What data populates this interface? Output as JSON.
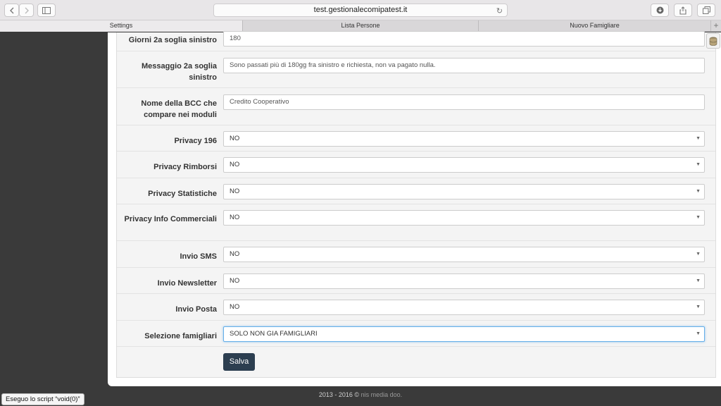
{
  "browser": {
    "url": "test.gestionalecomipatest.it",
    "tabs": [
      "Settings",
      "Lista Persone",
      "Nuovo Famigliare"
    ],
    "new_tab_glyph": "+"
  },
  "form": {
    "rows": [
      {
        "label": "Giorni 2a soglia sinistro",
        "value": "180",
        "type": "text"
      },
      {
        "label": "Messaggio 2a soglia sinistro",
        "value": "Sono passati più di 180gg fra sinistro e richiesta, non va pagato nulla.",
        "type": "text"
      },
      {
        "label": "Nome della BCC che compare nei moduli",
        "value": "Credito Cooperativo",
        "type": "text"
      },
      {
        "label": "Privacy 196",
        "value": "NO",
        "type": "select"
      },
      {
        "label": "Privacy Rimborsi",
        "value": "NO",
        "type": "select"
      },
      {
        "label": "Privacy Statistiche",
        "value": "NO",
        "type": "select"
      },
      {
        "label": "Privacy Info Commerciali",
        "value": "NO",
        "type": "select"
      },
      {
        "label": "Invio SMS",
        "value": "NO",
        "type": "select"
      },
      {
        "label": "Invio Newsletter",
        "value": "NO",
        "type": "select"
      },
      {
        "label": "Invio Posta",
        "value": "NO",
        "type": "select"
      },
      {
        "label": "Selezione famigliari",
        "value": "SOLO NON GIA FAMIGLIARI",
        "type": "select"
      }
    ],
    "save_label": "Salva"
  },
  "footer": {
    "copyright": "2013 - 2016 ©",
    "brand": "nis media doo."
  },
  "status_bar": {
    "text": "Eseguo lo script “void(0)”"
  },
  "colors": {
    "save_button": "#2c3e50",
    "page_background": "#3a3a3a",
    "focus_border": "#66afe9"
  }
}
